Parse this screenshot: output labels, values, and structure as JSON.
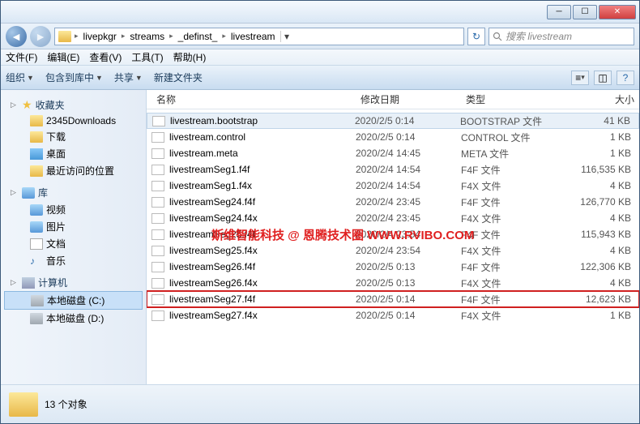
{
  "breadcrumbs": [
    "livepkgr",
    "streams",
    "_definst_",
    "livestream"
  ],
  "search_placeholder": "搜索 livestream",
  "menus": {
    "file": "文件(F)",
    "edit": "编辑(E)",
    "view": "查看(V)",
    "tools": "工具(T)",
    "help": "帮助(H)"
  },
  "cmdbar": {
    "organize": "组织",
    "include": "包含到库中",
    "share": "共享",
    "newfolder": "新建文件夹"
  },
  "columns": {
    "name": "名称",
    "date": "修改日期",
    "type": "类型",
    "size": "大小"
  },
  "sidebar": {
    "favorites": {
      "label": "收藏夹",
      "items": [
        "2345Downloads",
        "下载",
        "桌面",
        "最近访问的位置"
      ]
    },
    "libraries": {
      "label": "库",
      "items": [
        "视频",
        "图片",
        "文档",
        "音乐"
      ]
    },
    "computer": {
      "label": "计算机",
      "items": [
        "本地磁盘 (C:)",
        "本地磁盘 (D:)"
      ]
    }
  },
  "files": [
    {
      "name": "livestream.bootstrap",
      "date": "2020/2/5 0:14",
      "type": "BOOTSTRAP 文件",
      "size": "41 KB",
      "hl": 1
    },
    {
      "name": "livestream.control",
      "date": "2020/2/5 0:14",
      "type": "CONTROL 文件",
      "size": "1 KB"
    },
    {
      "name": "livestream.meta",
      "date": "2020/2/4 14:45",
      "type": "META 文件",
      "size": "1 KB"
    },
    {
      "name": "livestreamSeg1.f4f",
      "date": "2020/2/4 14:54",
      "type": "F4F 文件",
      "size": "116,535 KB"
    },
    {
      "name": "livestreamSeg1.f4x",
      "date": "2020/2/4 14:54",
      "type": "F4X 文件",
      "size": "4 KB"
    },
    {
      "name": "livestreamSeg24.f4f",
      "date": "2020/2/4 23:45",
      "type": "F4F 文件",
      "size": "126,770 KB"
    },
    {
      "name": "livestreamSeg24.f4x",
      "date": "2020/2/4 23:45",
      "type": "F4X 文件",
      "size": "4 KB"
    },
    {
      "name": "livestreamSeg25.f4f",
      "date": "2020/2/4 23:54",
      "type": "F4F 文件",
      "size": "115,943 KB"
    },
    {
      "name": "livestreamSeg25.f4x",
      "date": "2020/2/4 23:54",
      "type": "F4X 文件",
      "size": "4 KB"
    },
    {
      "name": "livestreamSeg26.f4f",
      "date": "2020/2/5 0:13",
      "type": "F4F 文件",
      "size": "122,306 KB"
    },
    {
      "name": "livestreamSeg26.f4x",
      "date": "2020/2/5 0:13",
      "type": "F4X 文件",
      "size": "4 KB"
    },
    {
      "name": "livestreamSeg27.f4f",
      "date": "2020/2/5 0:14",
      "type": "F4F 文件",
      "size": "12,623 KB",
      "hl": 2
    },
    {
      "name": "livestreamSeg27.f4x",
      "date": "2020/2/5 0:14",
      "type": "F4X 文件",
      "size": "1 KB"
    }
  ],
  "status": {
    "count": "13 个对象"
  },
  "watermark": "斯维智能科技 @ 恩腾技术圈 WWW.RVIBO.COM"
}
